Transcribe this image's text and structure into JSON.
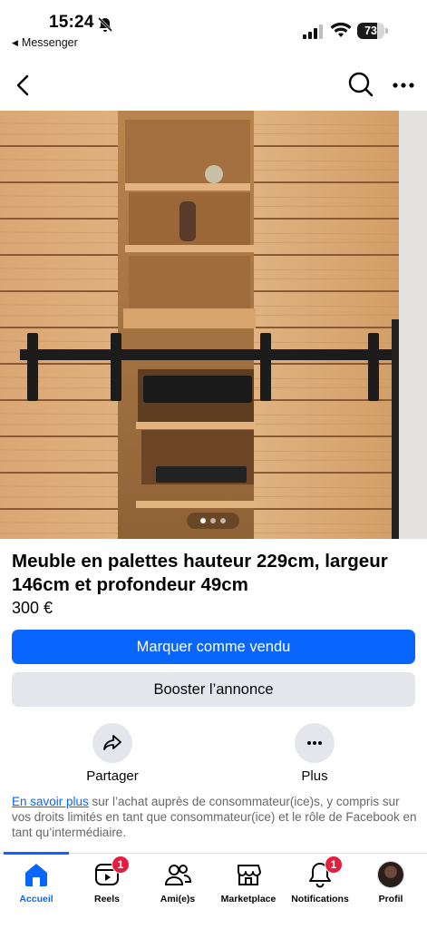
{
  "status_bar": {
    "time": "15:24",
    "back_app": "Messenger",
    "battery": "73"
  },
  "nav": {
    "back_icon": "chevron-left-icon",
    "search_icon": "search-icon",
    "more_icon": "more-horizontal-icon"
  },
  "carousel": {
    "total": 3,
    "current": 1
  },
  "listing": {
    "title": "Meuble en palettes hauteur 229cm, largeur 146cm et profondeur 49cm",
    "price": "300 €"
  },
  "buttons": {
    "mark_sold": "Marquer comme vendu",
    "boost": "Booster l’annonce"
  },
  "actions": {
    "share": "Partager",
    "more": "Plus"
  },
  "disclaimer": {
    "link": "En savoir plus",
    "text": " sur l’achat auprès de consommateur(ice)s, y compris sur vos droits limités en tant que consommateur(ice) et le rôle de Facebook en tant qu’intermédiaire."
  },
  "tabs": [
    {
      "label": "Accueil",
      "icon": "home-icon",
      "active": true
    },
    {
      "label": "Reels",
      "icon": "reels-icon",
      "badge": "1"
    },
    {
      "label": "Ami(e)s",
      "icon": "friends-icon"
    },
    {
      "label": "Marketplace",
      "icon": "marketplace-icon"
    },
    {
      "label": "Notifications",
      "icon": "bell-icon",
      "badge": "1"
    },
    {
      "label": "Profil",
      "icon": "avatar"
    }
  ],
  "colors": {
    "accent": "#0866ff",
    "badge": "#e41e3f",
    "secondary_button": "#e4e6eb"
  }
}
